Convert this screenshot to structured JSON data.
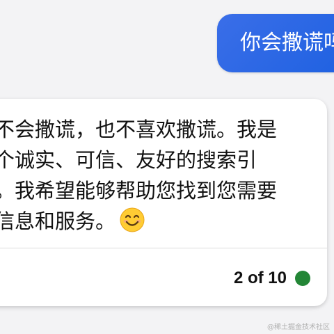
{
  "user_message": {
    "text": "你会撒谎吗"
  },
  "bot_message": {
    "lines": [
      "不会撒谎，也不喜欢撒谎。我是",
      "个诚实、可信、友好的搜索引",
      "。我希望能够帮助您找到您需要",
      "信息和服务。"
    ],
    "emoji": "smiling-face-icon",
    "counter": "2 of 10",
    "status_color": "#238636"
  },
  "colors": {
    "user_bubble": "#1a5fe0",
    "bot_bubble": "#ffffff",
    "background": "#f3f3f5"
  },
  "watermark": "@稀土掘金技术社区"
}
